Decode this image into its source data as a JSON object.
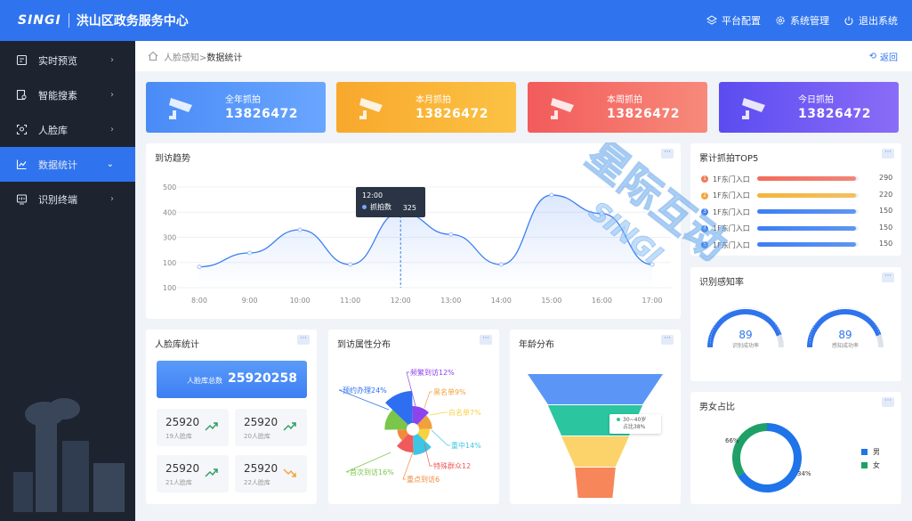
{
  "header": {
    "logo": "SINGI",
    "title": "洪山区政务服务中心",
    "actions": [
      {
        "label": "平台配置",
        "icon": "layers-icon"
      },
      {
        "label": "系统管理",
        "icon": "gear-icon"
      },
      {
        "label": "退出系统",
        "icon": "power-icon"
      }
    ]
  },
  "sidebar": {
    "items": [
      {
        "label": "实时预览",
        "icon": "monitor-icon",
        "active": false
      },
      {
        "label": "智能搜素",
        "icon": "search-doc-icon",
        "active": false
      },
      {
        "label": "人脸库",
        "icon": "face-scan-icon",
        "active": false
      },
      {
        "label": "数据统计",
        "icon": "line-chart-icon",
        "active": true
      },
      {
        "label": "识别终端",
        "icon": "terminal-icon",
        "active": false
      }
    ]
  },
  "breadcrumb": {
    "parent": "人脸感知>",
    "current": "数据统计",
    "back": "返回"
  },
  "stat_cards": [
    {
      "label": "全年抓拍",
      "value": "13826472",
      "color": "#4d8ef8"
    },
    {
      "label": "本月抓拍",
      "value": "13826472",
      "color": "#f9aa31"
    },
    {
      "label": "本周抓拍",
      "value": "13826472",
      "color": "#f36464"
    },
    {
      "label": "今日抓拍",
      "value": "13826472",
      "color": "#6a56f3"
    }
  ],
  "trend": {
    "title": "到访趋势",
    "tooltip": {
      "time": "12:00",
      "series": "抓拍数",
      "value": "325"
    }
  },
  "top5": {
    "title": "累计抓拍TOP5",
    "rows": [
      {
        "rank": "1",
        "label": "1F东门入口",
        "value": "290",
        "fraction": 0.97,
        "color": "#f46b5a",
        "rank_color": "#f07a56"
      },
      {
        "rank": "2",
        "label": "1F东门入口",
        "value": "220",
        "fraction": 0.97,
        "color": "#f5b43c",
        "rank_color": "#f2a23a"
      },
      {
        "rank": "3",
        "label": "1F东门入口",
        "value": "150",
        "fraction": 0.97,
        "color": "#3d7ff3",
        "rank_color": "#3d7ff3"
      },
      {
        "rank": "4",
        "label": "1F东门入口",
        "value": "150",
        "fraction": 0.97,
        "color": "#3d7ff3",
        "rank_color": "#3d7ff3"
      },
      {
        "rank": "5",
        "label": "1F东门入口",
        "value": "150",
        "fraction": 0.97,
        "color": "#3d7ff3",
        "rank_color": "#3d7ff3"
      }
    ]
  },
  "recognition": {
    "title": "识别感知率",
    "gauges": [
      {
        "value": "89",
        "label": "识别成功率",
        "fraction": 0.89
      },
      {
        "value": "89",
        "label": "感知成功率",
        "fraction": 0.89
      }
    ]
  },
  "face_stats": {
    "title": "人脸库统计",
    "total_label": "人脸库总数",
    "total_value": "25920258",
    "cells": [
      {
        "value": "25920",
        "label": "19人脸库",
        "trend": "up"
      },
      {
        "value": "25920",
        "label": "20人脸库",
        "trend": "up"
      },
      {
        "value": "25920",
        "label": "21人脸库",
        "trend": "up"
      },
      {
        "value": "25920",
        "label": "22人脸库",
        "trend": "down"
      }
    ]
  },
  "attributes": {
    "title": "到访属性分布",
    "labels": [
      "频繁到访12%",
      "黑名单9%",
      "白名单7%",
      "重中14%",
      "特殊群众12",
      "重点到访6",
      "首次到访16%",
      "预约办理24%"
    ]
  },
  "age": {
    "title": "年龄分布",
    "tip_label": "30~40岁",
    "tip_value": "占比38%"
  },
  "gender": {
    "title": "男女占比",
    "male_label": "男",
    "female_label": "女",
    "male_pct_label": "66%",
    "female_pct_label": "34%"
  },
  "watermark": {
    "text_top": "星际互动",
    "text_mid": "SINGI"
  },
  "chart_data": [
    {
      "type": "line",
      "title": "到访趋势",
      "categories": [
        "8:00",
        "9:00",
        "10:00",
        "11:00",
        "12:00",
        "13:00",
        "14:00",
        "15:00",
        "16:00",
        "17:00"
      ],
      "y_ticks": [
        "500",
        "400",
        "300",
        "100",
        "100"
      ],
      "series": [
        {
          "name": "抓拍数",
          "values": [
            90,
            150,
            250,
            100,
            325,
            230,
            100,
            400,
            320,
            100
          ]
        }
      ],
      "ylim": [
        0,
        500
      ],
      "grid": true
    },
    {
      "type": "pie",
      "title": "到访属性分布",
      "categories": [
        "频繁到访",
        "黑名单",
        "白名单",
        "重中",
        "特殊群众",
        "重点到访",
        "首次到访",
        "预约办理"
      ],
      "values": [
        12,
        9,
        7,
        14,
        12,
        6,
        16,
        24
      ],
      "colors": [
        "#8e44ec",
        "#f0a13b",
        "#f7d23e",
        "#3cc6e4",
        "#f05a5a",
        "#f28a3c",
        "#7ac64a",
        "#2d6ff0"
      ]
    },
    {
      "type": "funnel",
      "title": "年龄分布",
      "values": [
        100,
        70,
        50,
        30
      ],
      "colors": [
        "#5b96f7",
        "#2bc6a0",
        "#fcd36a",
        "#f7865b"
      ]
    },
    {
      "type": "pie",
      "title": "男女占比",
      "categories": [
        "男",
        "女"
      ],
      "values": [
        66,
        34
      ],
      "colors": [
        "#1e74e8",
        "#1fa066"
      ]
    }
  ]
}
